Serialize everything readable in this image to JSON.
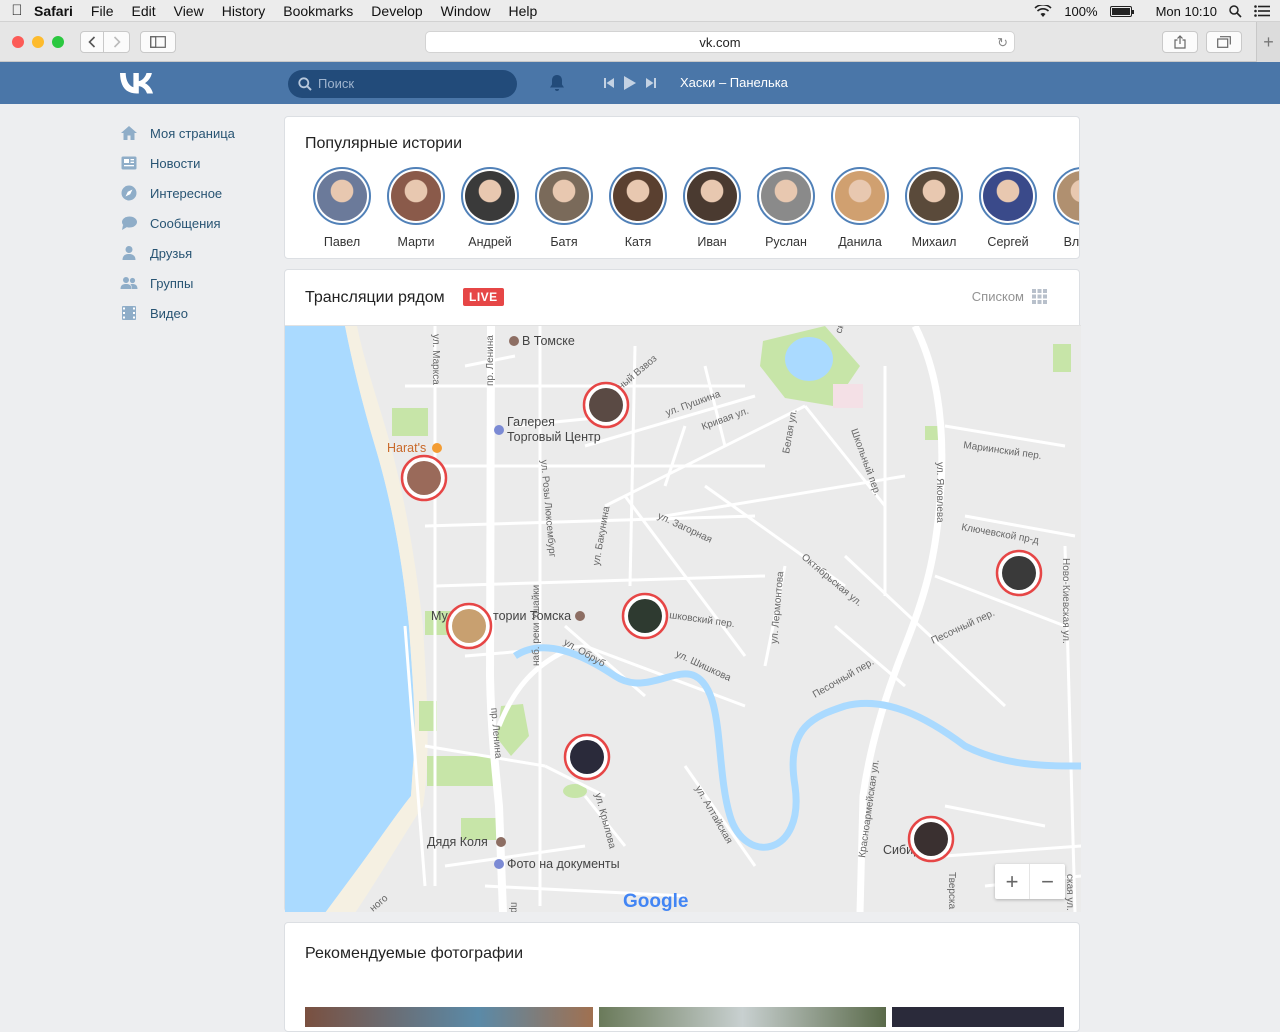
{
  "menubar": {
    "app": "Safari",
    "items": [
      "File",
      "Edit",
      "View",
      "History",
      "Bookmarks",
      "Develop",
      "Window",
      "Help"
    ],
    "battery": "100%",
    "clock": "Mon 10:10"
  },
  "browser": {
    "url": "vk.com"
  },
  "header": {
    "search_placeholder": "Поиск",
    "track": "Хаски – Панелька"
  },
  "sidebar": {
    "items": [
      {
        "label": "Моя страница",
        "icon": "home-icon"
      },
      {
        "label": "Новости",
        "icon": "news-icon"
      },
      {
        "label": "Интересное",
        "icon": "compass-icon"
      },
      {
        "label": "Сообщения",
        "icon": "messages-icon"
      },
      {
        "label": "Друзья",
        "icon": "friend-icon"
      },
      {
        "label": "Группы",
        "icon": "groups-icon"
      },
      {
        "label": "Видео",
        "icon": "video-icon"
      }
    ]
  },
  "stories": {
    "title": "Популярные истории",
    "people": [
      {
        "name": "Павел",
        "color": "#6b7a9a"
      },
      {
        "name": "Марти",
        "color": "#8a5a4a"
      },
      {
        "name": "Андрей",
        "color": "#3a3a3a"
      },
      {
        "name": "Батя",
        "color": "#7a6a5a"
      },
      {
        "name": "Катя",
        "color": "#5a4030"
      },
      {
        "name": "Иван",
        "color": "#4a3a30"
      },
      {
        "name": "Руслан",
        "color": "#8a8a8a"
      },
      {
        "name": "Данила",
        "color": "#d0a070"
      },
      {
        "name": "Михаил",
        "color": "#5a4a3a"
      },
      {
        "name": "Сергей",
        "color": "#3a4a8a"
      },
      {
        "name": "Влади",
        "color": "#b09070"
      }
    ]
  },
  "broadcasts": {
    "title": "Трансляции рядом",
    "live_badge": "LIVE",
    "list_label": "Списком",
    "map": {
      "places": [
        {
          "label": "В Томске"
        },
        {
          "label": "Галерея"
        },
        {
          "label": "Торговый Центр"
        },
        {
          "label": "Harat's"
        },
        {
          "label": "Му"
        },
        {
          "label": "тории Томска"
        },
        {
          "label": "Дядя Коля"
        },
        {
          "label": "Фото на документы"
        },
        {
          "label": "Сибир"
        }
      ],
      "streets": [
        "ул. Маркса",
        "пр. Ленина",
        "ул. Пушкина",
        "Кривая ул.",
        "Белая ул.",
        "Школьный пер.",
        "ул. Яковлева",
        "Мариинский пер.",
        "ул. Загорная",
        "Октябрьская ул.",
        "Ключевской пр-д",
        "ул. Бакунина",
        "ул. Розы Люксембург",
        "шковский пер.",
        "ул. Обруб",
        "ул. Шишкова",
        "ул. Лермонтова",
        "Песочный пер.",
        "Песочный пер.",
        "Ново-Киевская ул.",
        "наб. реки Ушайки",
        "пр. Ленина",
        "ул. Крылова",
        "ул. Алтайская",
        "Красноармейская ул.",
        "Тверска",
        "ская ул.",
        "ный Взвоз",
        "ская ул.",
        "ного",
        "пр."
      ],
      "attribution": "Google"
    },
    "zoom_in": "+",
    "zoom_out": "−"
  },
  "photos": {
    "title": "Рекомендуемые фотографии"
  }
}
